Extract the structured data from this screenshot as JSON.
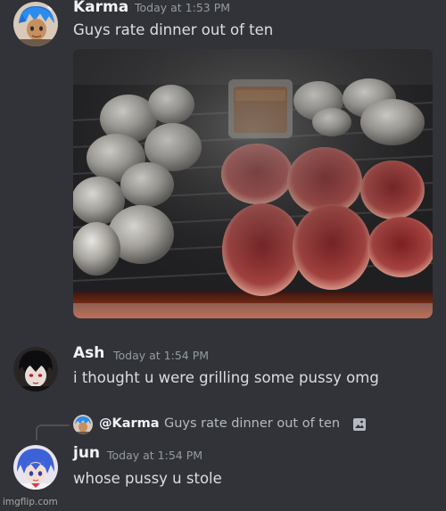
{
  "messages": [
    {
      "username": "Karma",
      "timestamp": "Today at 1:53 PM",
      "text": "Guys rate dinner out of ten",
      "attachment": "grill-photo"
    },
    {
      "username": "Ash",
      "timestamp": "Today at 1:54 PM",
      "text": "i thought u were grilling some pussy omg"
    },
    {
      "reply_to": {
        "username": "@Karma",
        "text": "Guys rate dinner out of ten",
        "icon": "image-icon"
      },
      "username": "jun",
      "timestamp": "Today at 1:54 PM",
      "text": "whose pussy u stole"
    }
  ],
  "watermark": "imgflip.com",
  "colors": {
    "background": "#313338",
    "username": "#f2f3f5",
    "timestamp": "#949ba4",
    "text": "#dbdee1"
  }
}
